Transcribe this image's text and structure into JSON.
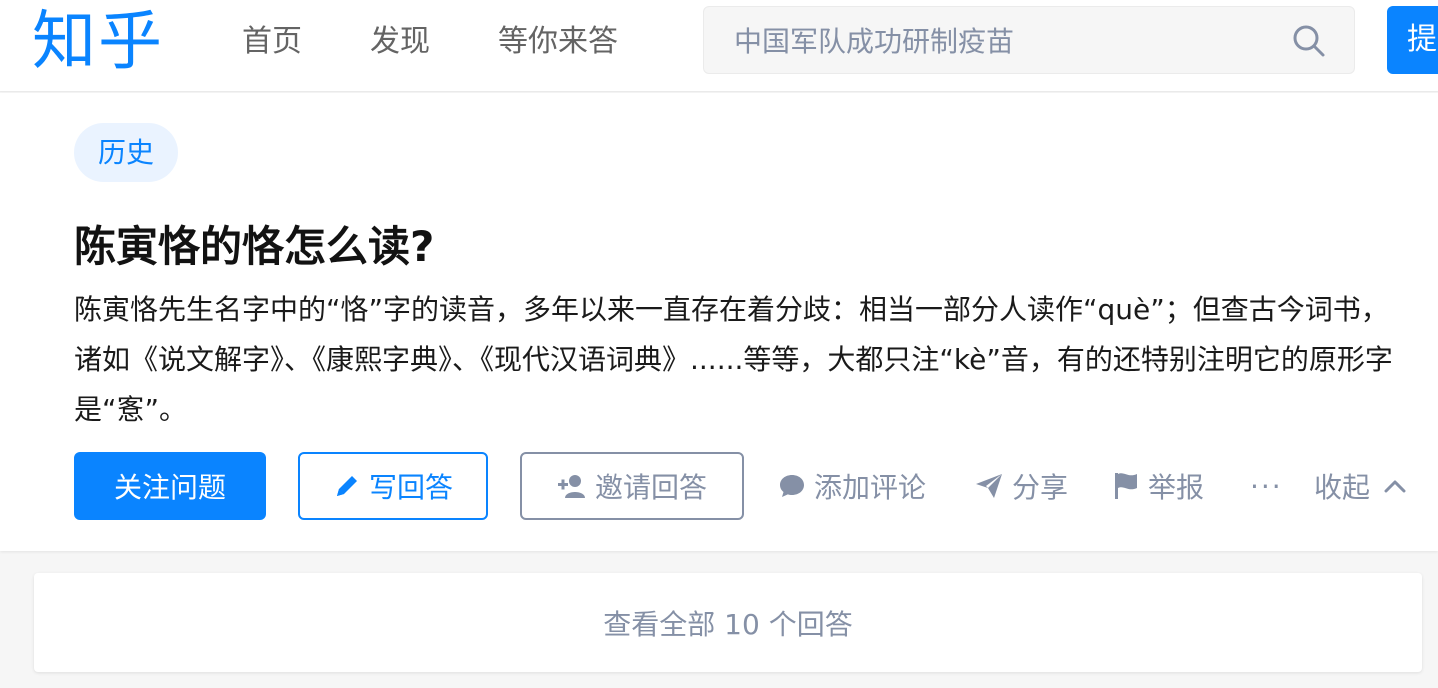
{
  "header": {
    "logo": "知乎",
    "nav": [
      "首页",
      "发现",
      "等你来答"
    ],
    "search_placeholder": "中国军队成功研制疫苗",
    "ask_label": "提问"
  },
  "question": {
    "topic": "历史",
    "title": "陈寅恪的恪怎么读?",
    "detail": "陈寅恪先生名字中的“恪”字的读音，多年以来一直存在着分歧：相当一部分人读作“què”；但查古今词书，诸如《说文解字》、《康熙字典》、《现代汉语词典》......等等，大都只注“kè”音，有的还特别注明它的原形字是“愙”。"
  },
  "actions": {
    "follow": "关注问题",
    "write_answer": "写回答",
    "invite": "邀请回答",
    "comment": "添加评论",
    "share": "分享",
    "report": "举报",
    "more": "···",
    "collapse": "收起"
  },
  "answers": {
    "view_all": "查看全部 10 个回答"
  },
  "colors": {
    "brand": "#0a84ff",
    "muted": "#8590a6",
    "tag_bg": "#eaf3ff"
  }
}
